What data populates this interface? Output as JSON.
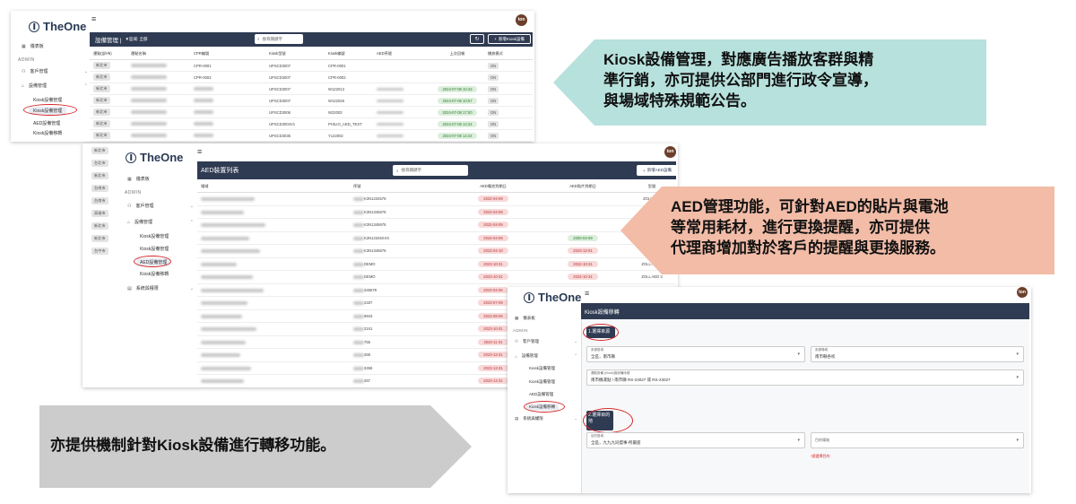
{
  "brand": "TheOne",
  "avatar": "ton",
  "sidebar": {
    "dashboard": "儀表板",
    "admin": "ADMIN",
    "customer": "客戶管理",
    "device": "設備管理",
    "subs": [
      "Kiosk設備管理",
      "Kiosk設備管理",
      "AED設備管理",
      "Kiosk設備移轉"
    ],
    "system": "系統與權限"
  },
  "kiosk": {
    "header": "設備管理 |",
    "filter": "▼區域: 全部",
    "search_placeholder": "搜尋關鍵字",
    "refresh_icon": "refresh-icon",
    "add_label": "新增Kiosk設備",
    "columns": [
      "運點(部/市)",
      "運點名稱",
      "CPR編號",
      "Kiosk型號",
      "Kiosk編號",
      "AED序號",
      "上次回報",
      "播放模式"
    ],
    "region": "新北市",
    "rows": [
      {
        "cpr": "CPR-0001",
        "model": "UPSCD3007",
        "no": "CPR-0001",
        "aed": "",
        "date": "",
        "mode": "ON"
      },
      {
        "cpr": "CPR-0002",
        "model": "UPSCD3007",
        "no": "CPR-0002",
        "aed": "",
        "date": "",
        "mode": "ON"
      },
      {
        "cpr": "",
        "model": "UPSCD3007",
        "no": "W122013",
        "aed": "",
        "date": "2024-07-08 10:43",
        "mode": "ON"
      },
      {
        "cpr": "",
        "model": "UPSCD3007",
        "no": "W122026",
        "aed": "",
        "date": "2024-07-08 10:57",
        "mode": "ON"
      },
      {
        "cpr": "",
        "model": "UPSCD3006",
        "no": "W22002",
        "aed": "",
        "date": "2024-07-08 17:00",
        "mode": "ON"
      },
      {
        "cpr": "",
        "model": "UPSCD3004V1",
        "no": "PHILIO_AED_TEST",
        "aed": "",
        "date": "2024-07-08 14:24",
        "mode": "ON"
      },
      {
        "cpr": "",
        "model": "UPSCD3035",
        "no": "Y122002",
        "aed": "",
        "date": "2024-07-08 14:24",
        "mode": "ON"
      }
    ],
    "extra_regions": [
      "新北市",
      "台北市",
      "新北市",
      "台南市",
      "台南市",
      "高雄市",
      "新北市",
      "新北市",
      "台中市"
    ]
  },
  "aed": {
    "title": "AED裝置列表",
    "search_placeholder": "搜尋關鍵字",
    "add_label": "新增AED設備",
    "columns": [
      "場域",
      "序號",
      "AED電池到期日",
      "AED貼片到期日",
      "型號"
    ],
    "rows": [
      {
        "sn": "K3N1234576",
        "pad": "2022-04-09",
        "batt": "",
        "model": "ZOLL AED"
      },
      {
        "sn": "K3N1345676",
        "pad": "2022-04-09",
        "batt": "",
        "model": ""
      },
      {
        "sn": "K3N1345676",
        "pad": "2022-04-09",
        "batt": "",
        "model": ""
      },
      {
        "sn": "K3N12345XXX",
        "pad": "2024-04-09",
        "batt": "2000-04-09",
        "model": ""
      },
      {
        "sn": "K3N1345676",
        "pad": "2023-04-10",
        "batt": "2023-12-01",
        "model": ""
      },
      {
        "sn": "DEMO",
        "pad": "2023-10-31",
        "batt": "2022-10-31",
        "model": "ZOLL AED 3"
      },
      {
        "sn": "DEMO",
        "pad": "2023-10-31",
        "batt": "2022-10-31",
        "model": "ZOLL AED 3"
      },
      {
        "sn": "345678",
        "pad": "2023-04-05",
        "batt": "",
        "model": ""
      },
      {
        "sn": "2337",
        "pad": "2023-07-09",
        "batt": "",
        "model": ""
      },
      {
        "sn": "9943",
        "pad": "2023-08-09",
        "batt": "",
        "model": ""
      },
      {
        "sn": "2241",
        "pad": "2023-10-31",
        "batt": "",
        "model": ""
      },
      {
        "sn": "755",
        "pad": "2023-11-31",
        "batt": "",
        "model": ""
      },
      {
        "sn": "268",
        "pad": "2023-12-31",
        "batt": "",
        "model": ""
      },
      {
        "sn": "3456",
        "pad": "2023-12-31",
        "batt": "",
        "model": ""
      },
      {
        "sn": "267",
        "pad": "2023-12-31",
        "batt": "",
        "model": ""
      }
    ]
  },
  "transfer": {
    "title": "Kiosk設備移轉",
    "step1": "1.選擇來源",
    "step2a": "2.選擇目的",
    "step2b": "地",
    "src_region_label": "來源區域",
    "src_region_value": "全區，南市縣",
    "src_site_label": "來源場域",
    "src_site_value": "南市縣各校",
    "src_dev_label": "選取設備 (Kiosk)與設備序號",
    "src_dev_value": "南市機運點 / 南市縣 RS-23027 或 RS-23027",
    "dst_region_label": "目的區域",
    "dst_region_value": "全區，九九九同盟事-所屬座",
    "dst_site_label": "目的場域",
    "dst_site_value": "",
    "warning": "*請選擇目的"
  },
  "callouts": {
    "kiosk": [
      "Kiosk設備管理，對應廣告播放客群與精",
      "準行銷，亦可提供公部門進行政令宣導，",
      "與場域特殊規範公告。"
    ],
    "aed": [
      "AED管理功能，可針對AED的貼片與電池",
      "等常用耗材，進行更換提醒，亦可提供",
      "代理商增加對於客戶的提醒與更換服務。"
    ],
    "transfer": "亦提供機制針對Kiosk設備進行轉移功能。"
  },
  "colors": {
    "callout_kiosk": "#b7e1dc",
    "callout_aed": "#f2bca7",
    "callout_transfer": "#cccccc",
    "header_dark": "#2f3b52"
  }
}
